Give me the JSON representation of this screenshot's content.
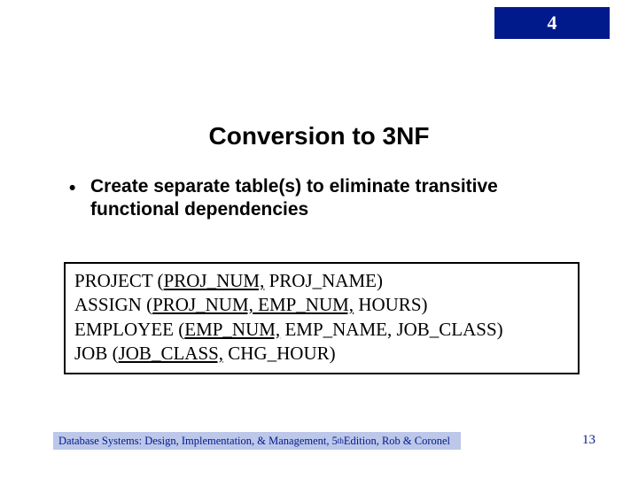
{
  "chapter": "4",
  "title": "Conversion to 3NF",
  "bullet": "Create separate table(s) to eliminate transitive functional dependencies",
  "schema": {
    "line1_prefix": "PROJECT (",
    "line1_key": "PROJ_NUM,",
    "line1_rest": " PROJ_NAME)",
    "line2_prefix": "ASSIGN (",
    "line2_key": "PROJ_NUM, EMP_NUM,",
    "line2_rest": " HOURS)",
    "line3_prefix": "EMPLOYEE (",
    "line3_key": "EMP_NUM,",
    "line3_rest": " EMP_NAME, JOB_CLASS)",
    "line4_prefix": "JOB (",
    "line4_key": "JOB_CLASS,",
    "line4_rest": " CHG_HOUR)"
  },
  "footer_a": "Database Systems: Design, Implementation, & Management, 5",
  "footer_sup": "th",
  "footer_b": " Edition, Rob & Coronel",
  "page": "13"
}
